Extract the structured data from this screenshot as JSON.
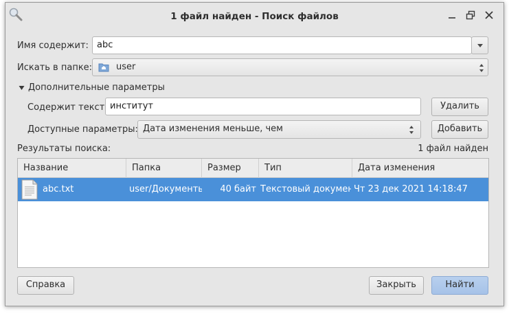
{
  "window": {
    "title": "1 файл найден - Поиск файлов"
  },
  "form": {
    "name_label": "Имя содержит:",
    "name_value": "abc",
    "folder_label": "Искать в папке:",
    "folder_value": "user",
    "advanced_toggle": "Дополнительные параметры",
    "contains_label": "Содержит текст:",
    "contains_value": "институт",
    "remove_button": "Удалить",
    "available_label": "Доступные параметры:",
    "available_value": "Дата изменения меньше, чем",
    "add_button": "Добавить"
  },
  "results": {
    "label": "Результаты поиска:",
    "count": "1 файл найден",
    "columns": [
      "Название",
      "Папка",
      "Размер",
      "Тип",
      "Дата изменения"
    ],
    "rows": [
      {
        "name": "abc.txt",
        "folder": "user/Документы",
        "size": "40 байт",
        "type": "Текстовый документ",
        "modified": "Чт 23 дек 2021 14:18:47",
        "icon": "text-file-icon"
      }
    ]
  },
  "footer": {
    "help_button": "Справка",
    "close_button": "Закрыть",
    "find_button": "Найти"
  },
  "colors": {
    "selection": "#4a90d9",
    "primary_button": "#a6c2e8"
  }
}
